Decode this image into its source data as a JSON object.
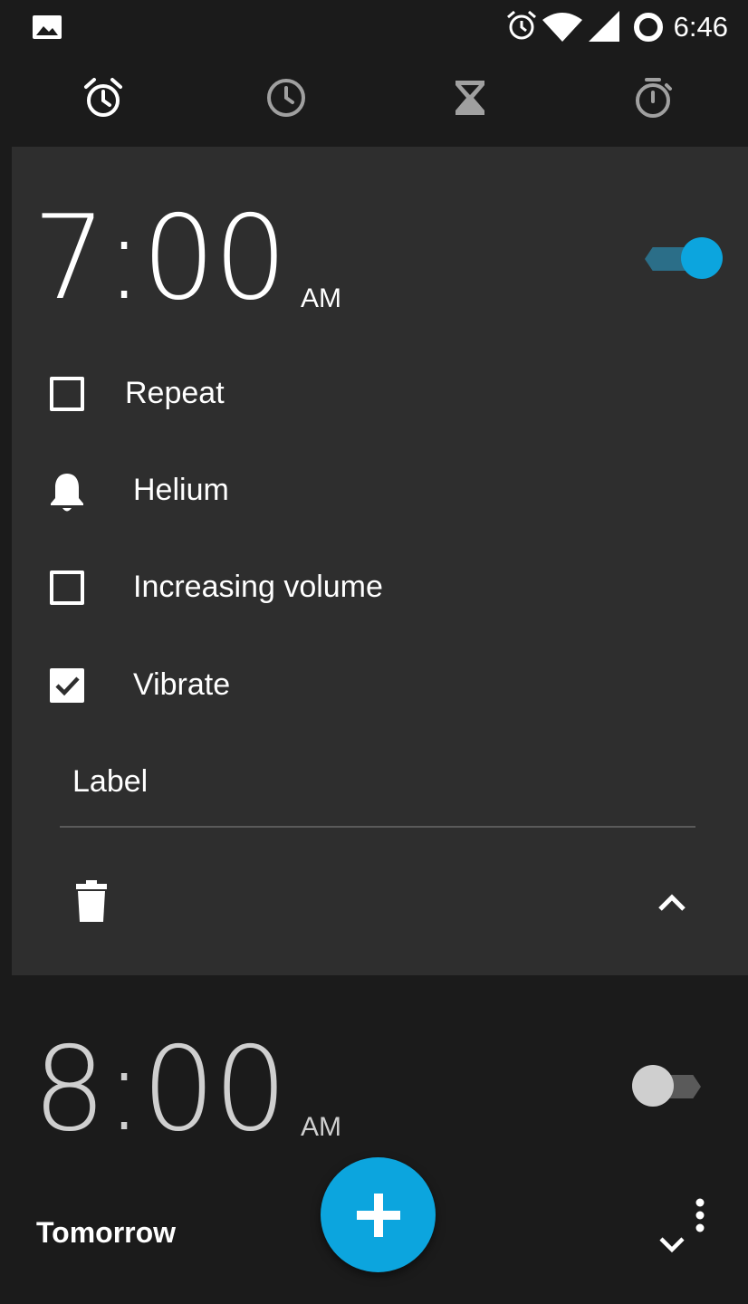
{
  "status_bar": {
    "time": "6:46",
    "icons": [
      "gallery-icon",
      "alarm-icon",
      "wifi-icon",
      "signal-icon",
      "battery-icon"
    ]
  },
  "tabs": [
    {
      "name": "alarm",
      "icon": "alarm-clock-icon",
      "selected": true
    },
    {
      "name": "clock",
      "icon": "clock-icon",
      "selected": false
    },
    {
      "name": "timer",
      "icon": "hourglass-icon",
      "selected": false
    },
    {
      "name": "stopwatch",
      "icon": "stopwatch-icon",
      "selected": false
    }
  ],
  "alarms": [
    {
      "time": "7:00",
      "ampm": "AM",
      "enabled": true,
      "expanded": true,
      "repeat_label": "Repeat",
      "repeat_checked": false,
      "ringtone": "Helium",
      "increasing_volume_label": "Increasing volume",
      "increasing_volume_checked": false,
      "vibrate_label": "Vibrate",
      "vibrate_checked": true,
      "label_placeholder": "Label"
    },
    {
      "time": "8:00",
      "ampm": "AM",
      "enabled": false,
      "expanded": false,
      "day_text": "Tomorrow"
    }
  ],
  "colors": {
    "accent": "#0ca5de",
    "toggle_track_on": "#2b6e88",
    "background": "#1b1b1b",
    "card": "#2e2e2e"
  }
}
